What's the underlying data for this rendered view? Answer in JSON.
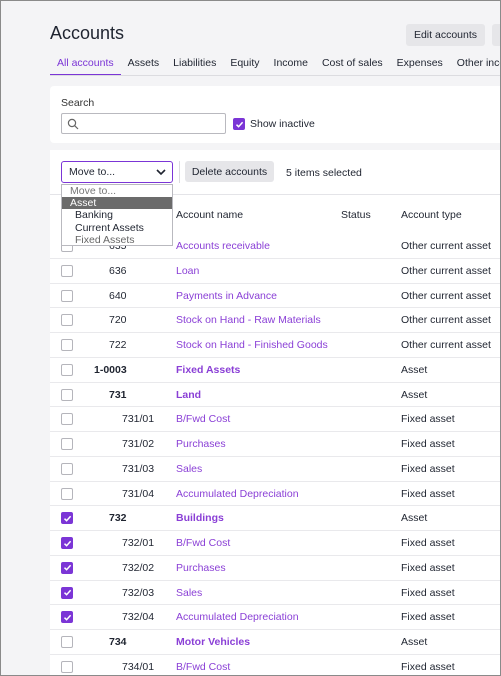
{
  "header": {
    "title": "Accounts",
    "edit_button": "Edit accounts"
  },
  "tabs": [
    "All accounts",
    "Assets",
    "Liabilities",
    "Equity",
    "Income",
    "Cost of sales",
    "Expenses",
    "Other inco"
  ],
  "active_tab": "All accounts",
  "search": {
    "label": "Search",
    "value": "",
    "placeholder": "",
    "show_inactive_label": "Show inactive",
    "show_inactive_checked": true
  },
  "bulk": {
    "move_select_value": "Move to...",
    "delete_button": "Delete accounts",
    "selected_text": "5 items selected"
  },
  "dropdown": {
    "options": [
      {
        "label": "Move to...",
        "kind": "placeholder"
      },
      {
        "label": "Asset",
        "kind": "highlighted"
      },
      {
        "label": "Banking",
        "kind": "sub"
      },
      {
        "label": "Current Assets",
        "kind": "sub"
      },
      {
        "label": "Fixed Assets",
        "kind": "sub-dim"
      }
    ]
  },
  "table": {
    "columns": {
      "name": "Account name",
      "status": "Status",
      "type": "Account type"
    },
    "rows": [
      {
        "code": "635",
        "name": "Accounts receivable",
        "type": "Other current asset",
        "checked": false,
        "level": 1,
        "bold": false
      },
      {
        "code": "636",
        "name": "Loan",
        "type": "Other current asset",
        "checked": false,
        "level": 1,
        "bold": false
      },
      {
        "code": "640",
        "name": "Payments in Advance",
        "type": "Other current asset",
        "checked": false,
        "level": 1,
        "bold": false
      },
      {
        "code": "720",
        "name": "Stock on Hand - Raw Materials",
        "type": "Other current asset",
        "checked": false,
        "level": 1,
        "bold": false
      },
      {
        "code": "722",
        "name": "Stock on Hand - Finished Goods",
        "type": "Other current asset",
        "checked": false,
        "level": 1,
        "bold": false
      },
      {
        "code": "1-0003",
        "name": "Fixed Assets",
        "type": "Asset",
        "checked": false,
        "level": 0,
        "bold": true
      },
      {
        "code": "731",
        "name": "Land",
        "type": "Asset",
        "checked": false,
        "level": 1,
        "bold": true
      },
      {
        "code": "731/01",
        "name": "B/Fwd Cost",
        "type": "Fixed asset",
        "checked": false,
        "level": 2,
        "bold": false
      },
      {
        "code": "731/02",
        "name": "Purchases",
        "type": "Fixed asset",
        "checked": false,
        "level": 2,
        "bold": false
      },
      {
        "code": "731/03",
        "name": "Sales",
        "type": "Fixed asset",
        "checked": false,
        "level": 2,
        "bold": false
      },
      {
        "code": "731/04",
        "name": "Accumulated Depreciation",
        "type": "Fixed asset",
        "checked": false,
        "level": 2,
        "bold": false
      },
      {
        "code": "732",
        "name": "Buildings",
        "type": "Asset",
        "checked": true,
        "level": 1,
        "bold": true
      },
      {
        "code": "732/01",
        "name": "B/Fwd Cost",
        "type": "Fixed asset",
        "checked": true,
        "level": 2,
        "bold": false
      },
      {
        "code": "732/02",
        "name": "Purchases",
        "type": "Fixed asset",
        "checked": true,
        "level": 2,
        "bold": false
      },
      {
        "code": "732/03",
        "name": "Sales",
        "type": "Fixed asset",
        "checked": true,
        "level": 2,
        "bold": false
      },
      {
        "code": "732/04",
        "name": "Accumulated Depreciation",
        "type": "Fixed asset",
        "checked": true,
        "level": 2,
        "bold": false
      },
      {
        "code": "734",
        "name": "Motor Vehicles",
        "type": "Asset",
        "checked": false,
        "level": 1,
        "bold": true
      },
      {
        "code": "734/01",
        "name": "B/Fwd Cost",
        "type": "Fixed asset",
        "checked": false,
        "level": 2,
        "bold": false
      }
    ]
  },
  "colors": {
    "accent": "#7b35d6",
    "link": "#8a3fd6",
    "background": "#f4f4f6"
  }
}
